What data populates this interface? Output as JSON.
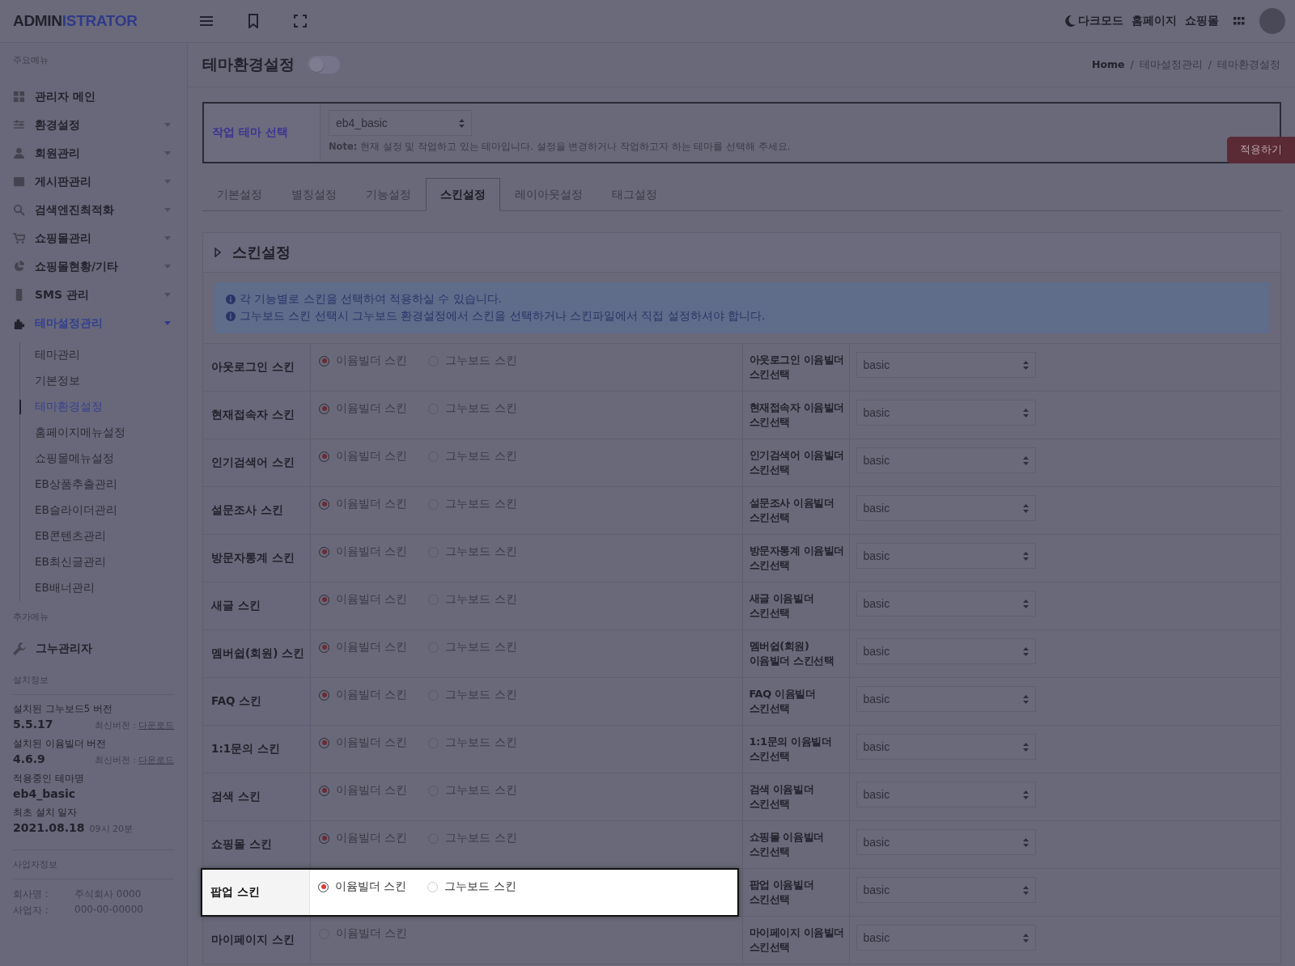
{
  "header": {
    "logo_dark": "ADMIN",
    "logo_blue": "ISTRATOR",
    "links": [
      {
        "label": "다크모드",
        "kind": "moon"
      },
      {
        "label": "홈페이지",
        "kind": "text"
      },
      {
        "label": "쇼핑몰",
        "kind": "text"
      }
    ]
  },
  "sidebar": {
    "section_title": "주요메뉴",
    "items": [
      {
        "label": "관리자 메인",
        "expandable": false,
        "selected": false
      },
      {
        "label": "환경설정",
        "expandable": true,
        "selected": false
      },
      {
        "label": "회원관리",
        "expandable": true,
        "selected": false
      },
      {
        "label": "게시판관리",
        "expandable": true,
        "selected": false
      },
      {
        "label": "검색엔진최적화",
        "expandable": true,
        "selected": false
      },
      {
        "label": "쇼핑몰관리",
        "expandable": true,
        "selected": false
      },
      {
        "label": "쇼핑몰현황/기타",
        "expandable": true,
        "selected": false
      },
      {
        "label": "SMS 관리",
        "expandable": true,
        "selected": false
      },
      {
        "label": "테마설정관리",
        "expandable": true,
        "selected": true,
        "children": [
          {
            "label": "테마관리",
            "selected": false
          },
          {
            "label": "기본정보",
            "selected": false
          },
          {
            "label": "테마환경설정",
            "selected": true
          },
          {
            "label": "홈페이지메뉴설정",
            "selected": false
          },
          {
            "label": "쇼핑몰메뉴설정",
            "selected": false
          },
          {
            "label": "EB상품추출관리",
            "selected": false
          },
          {
            "label": "EB슬라이더관리",
            "selected": false
          },
          {
            "label": "EB콘텐츠관리",
            "selected": false
          },
          {
            "label": "EB최신글관리",
            "selected": false
          },
          {
            "label": "EB배너관리",
            "selected": false
          }
        ]
      }
    ],
    "extra_title": "추가메뉴",
    "extra_item": "그누관리자",
    "install_title": "설치정보",
    "install": [
      {
        "label": "설치된 그누보드5 버전",
        "value": "5.5.17",
        "latest": "최신버전 :",
        "link": "다운로드"
      },
      {
        "label": "설치된 이윰빌더 버전",
        "value": "4.6.9",
        "latest": "최신버전 :",
        "link": "다운로드"
      },
      {
        "label": "적용중인 테마명",
        "value": "eb4_basic"
      },
      {
        "label": "최초 설치 일자",
        "value": "2021.08.18",
        "note": "09시 20분"
      }
    ],
    "business_title": "사업자정보",
    "business": [
      {
        "label": "회사명 :",
        "value": "주식회사 0000"
      },
      {
        "label": "사업자 :",
        "value": "000-00-00000"
      }
    ]
  },
  "page": {
    "title": "테마환경설정",
    "toggle_on": false,
    "breadcrumb": [
      "Home",
      "테마설정관리",
      "테마환경설정"
    ],
    "breadcrumb_separator": "/"
  },
  "theme_select": {
    "label": "작업 테마 선택",
    "value": "eb4_basic",
    "note": "**Note:** 현재 설정 및 작업하고 있는 테마입니다. 설정을 변경하거나 작업하고자 하는 테마를 선택해 주세요.",
    "apply": "적용하기"
  },
  "tabs": [
    {
      "label": "기본설정",
      "selected": false
    },
    {
      "label": "별칭설정",
      "selected": false
    },
    {
      "label": "기능설정",
      "selected": false
    },
    {
      "label": "스킨설정",
      "selected": true
    },
    {
      "label": "레이아웃설정",
      "selected": false
    },
    {
      "label": "태그설정",
      "selected": false
    }
  ],
  "panel": {
    "title": "스킨설정",
    "info": [
      "각 기능별로 스킨을 선택하여 적용하실 수 있습니다.",
      "그누보드 스킨 선택시 그누보드 환경설정에서 스킨을 선택하거나 스킨파일에서 직접 설정하셔야 합니다."
    ],
    "rows": [
      {
        "label": "아웃로그인 스킨",
        "highlighted": false,
        "options": [
          {
            "label": "이윰빌더 스킨",
            "selected": true
          },
          {
            "label": "그누보드 스킨",
            "selected": false
          }
        ],
        "select_label": "아웃로그인 이윰빌더 스킨선택",
        "select_value": "basic"
      },
      {
        "label": "현재접속자 스킨",
        "highlighted": false,
        "options": [
          {
            "label": "이윰빌더 스킨",
            "selected": true
          },
          {
            "label": "그누보드 스킨",
            "selected": false
          }
        ],
        "select_label": "현재접속자 이윰빌더 스킨선택",
        "select_value": "basic"
      },
      {
        "label": "인기검색어 스킨",
        "highlighted": false,
        "options": [
          {
            "label": "이윰빌더 스킨",
            "selected": true
          },
          {
            "label": "그누보드 스킨",
            "selected": false
          }
        ],
        "select_label": "인기검색어 이윰빌더 스킨선택",
        "select_value": "basic"
      },
      {
        "label": "설문조사 스킨",
        "highlighted": false,
        "options": [
          {
            "label": "이윰빌더 스킨",
            "selected": true
          },
          {
            "label": "그누보드 스킨",
            "selected": false
          }
        ],
        "select_label": "설문조사 이윰빌더 스킨선택",
        "select_value": "basic"
      },
      {
        "label": "방문자통계 스킨",
        "highlighted": false,
        "options": [
          {
            "label": "이윰빌더 스킨",
            "selected": true
          },
          {
            "label": "그누보드 스킨",
            "selected": false
          }
        ],
        "select_label": "방문자통계 이윰빌더 스킨선택",
        "select_value": "basic"
      },
      {
        "label": "새글 스킨",
        "highlighted": false,
        "options": [
          {
            "label": "이윰빌더 스킨",
            "selected": true
          },
          {
            "label": "그누보드 스킨",
            "selected": false
          }
        ],
        "select_label": "새글 이윰빌더 스킨선택",
        "select_value": "basic"
      },
      {
        "label": "멤버쉽(회원) 스킨",
        "highlighted": false,
        "options": [
          {
            "label": "이윰빌더 스킨",
            "selected": true
          },
          {
            "label": "그누보드 스킨",
            "selected": false
          }
        ],
        "select_label": "멤버쉽(회원) 이윰빌더 스킨선택",
        "select_value": "basic"
      },
      {
        "label": "FAQ 스킨",
        "highlighted": false,
        "options": [
          {
            "label": "이윰빌더 스킨",
            "selected": true
          },
          {
            "label": "그누보드 스킨",
            "selected": false
          }
        ],
        "select_label": "FAQ 이윰빌더 스킨선택",
        "select_value": "basic"
      },
      {
        "label": "1:1문의 스킨",
        "highlighted": false,
        "options": [
          {
            "label": "이윰빌더 스킨",
            "selected": true
          },
          {
            "label": "그누보드 스킨",
            "selected": false
          }
        ],
        "select_label": "1:1문의 이윰빌더 스킨선택",
        "select_value": "basic"
      },
      {
        "label": "검색 스킨",
        "highlighted": false,
        "options": [
          {
            "label": "이윰빌더 스킨",
            "selected": true
          },
          {
            "label": "그누보드 스킨",
            "selected": false
          }
        ],
        "select_label": "검색 이윰빌더 스킨선택",
        "select_value": "basic"
      },
      {
        "label": "쇼핑몰 스킨",
        "highlighted": false,
        "options": [
          {
            "label": "이윰빌더 스킨",
            "selected": true
          },
          {
            "label": "그누보드 스킨",
            "selected": false
          }
        ],
        "select_label": "쇼핑몰 이윰빌더 스킨선택",
        "select_value": "basic"
      },
      {
        "label": "팝업 스킨",
        "highlighted": true,
        "options": [
          {
            "label": "이윰빌더 스킨",
            "selected": true
          },
          {
            "label": "그누보드 스킨",
            "selected": false
          }
        ],
        "select_label": "팝업 이윰빌더 스킨선택",
        "select_value": "basic"
      },
      {
        "label": "마이페이지 스킨",
        "highlighted": false,
        "options": [
          {
            "label": "이윰빌더 스킨",
            "selected": false
          }
        ],
        "select_label": "마이페이지 이윰빌더 스킨선택",
        "select_value": "basic"
      }
    ]
  }
}
